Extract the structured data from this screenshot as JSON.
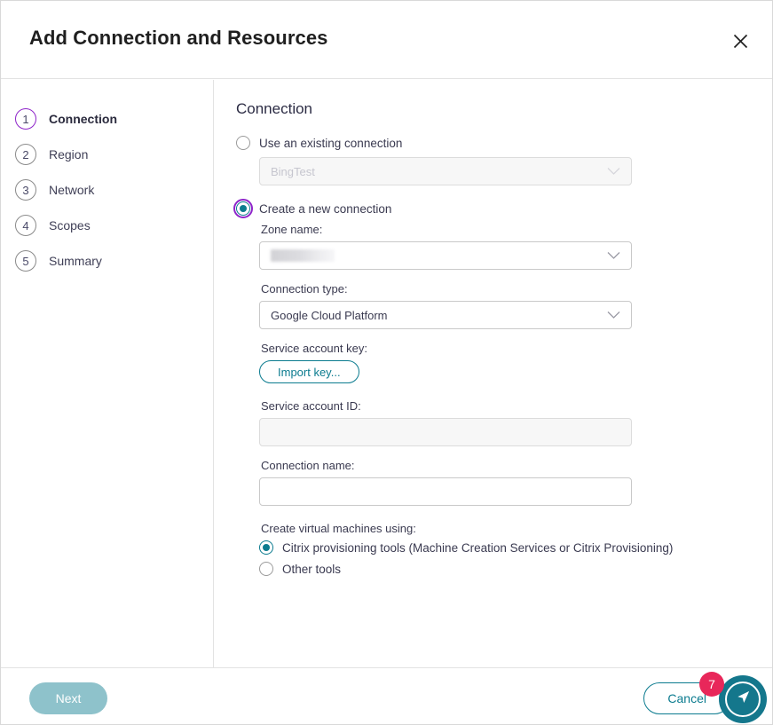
{
  "dialog": {
    "title": "Add Connection and Resources",
    "close_icon": "close-icon"
  },
  "sidebar": {
    "steps": [
      {
        "num": "1",
        "label": "Connection"
      },
      {
        "num": "2",
        "label": "Region"
      },
      {
        "num": "3",
        "label": "Network"
      },
      {
        "num": "4",
        "label": "Scopes"
      },
      {
        "num": "5",
        "label": "Summary"
      }
    ]
  },
  "main": {
    "heading": "Connection",
    "existing_connection": {
      "radio_label": "Use an existing connection",
      "dropdown_value": "BingTest",
      "chevron_icon": "chevron-down-icon"
    },
    "new_connection": {
      "radio_label": "Create a new connection",
      "zone_label": "Zone name:",
      "zone_value": "",
      "connection_type_label": "Connection type:",
      "connection_type_value": "Google Cloud Platform",
      "service_account_key_label": "Service account key:",
      "import_key_button": "Import key...",
      "service_account_id_label": "Service account ID:",
      "service_account_id_value": "",
      "connection_name_label": "Connection name:",
      "connection_name_value": ""
    },
    "vm_tools": {
      "group_label": "Create virtual machines using:",
      "options": [
        "Citrix provisioning tools (Machine Creation Services or Citrix Provisioning)",
        "Other tools"
      ]
    }
  },
  "footer": {
    "next_label": "Next",
    "cancel_label": "Cancel"
  },
  "fab": {
    "badge_count": "7",
    "icon": "navigation-arrow-icon"
  },
  "colors": {
    "accent_teal": "#0b7b8f",
    "focus_purple": "#8e24c9",
    "badge_pink": "#e8275a",
    "disabled_teal": "#8ec2cb"
  }
}
